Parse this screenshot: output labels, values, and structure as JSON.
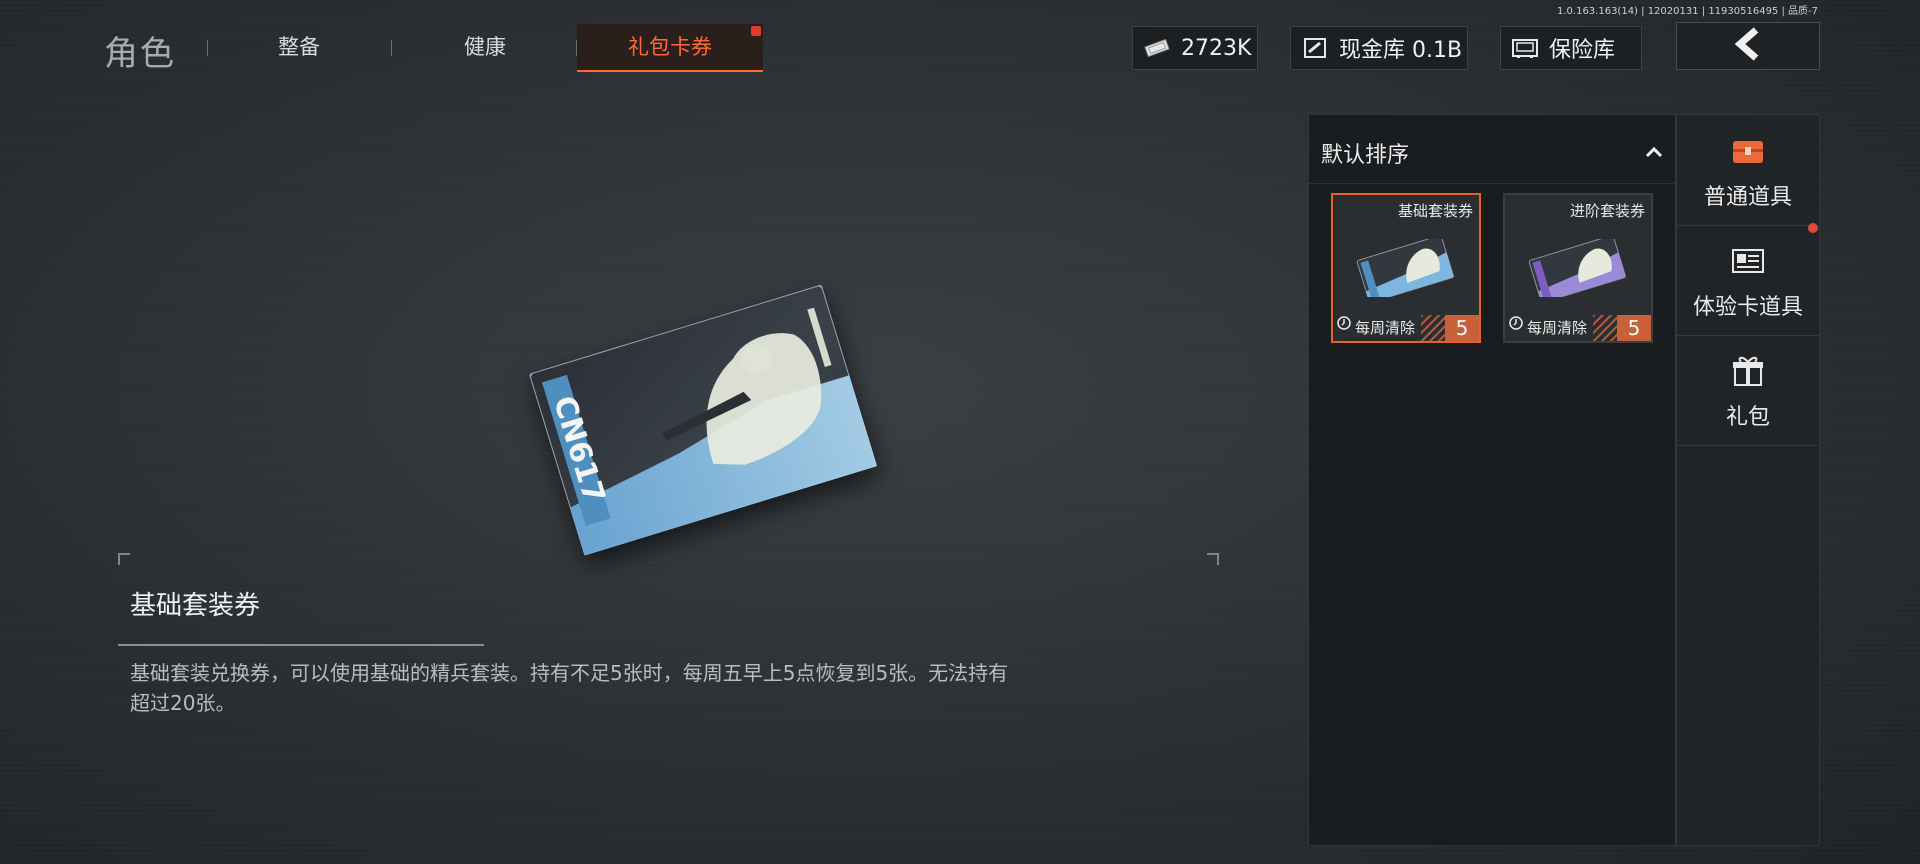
{
  "version": "1.0.163.163(14) | 12020131 | 11930516495 | 品质-7",
  "nav": {
    "title": "角色",
    "tabs": [
      {
        "label": "整备"
      },
      {
        "label": "健康"
      },
      {
        "label": "礼包卡券",
        "active": true
      }
    ]
  },
  "currency": {
    "cash": "2723K",
    "vault": "现金库 0.1B",
    "safe": "保险库"
  },
  "card_text": {
    "logo": "CN617"
  },
  "selected_item": {
    "name": "基础套装券",
    "description": "基础套装兑换券，可以使用基础的精兵套装。持有不足5张时，每周五早上5点恢复到5张。无法持有超过20张。"
  },
  "inventory": {
    "sort_label": "默认排序",
    "items": [
      {
        "name": "基础套装券",
        "reset": "每周清除",
        "count": "5",
        "selected": true,
        "accent": "#4f8fc0"
      },
      {
        "name": "进阶套装券",
        "reset": "每周清除",
        "count": "5",
        "selected": false,
        "accent": "#7a5fc0"
      }
    ]
  },
  "side_menu": [
    {
      "label": "普通道具",
      "icon": "chest-icon"
    },
    {
      "label": "体验卡道具",
      "icon": "trial-card-icon"
    },
    {
      "label": "礼包",
      "icon": "gift-icon"
    }
  ],
  "colors": {
    "accent": "#ff6a33",
    "count_badge": "#c8603a",
    "badge_dot": "#e23a2e"
  }
}
